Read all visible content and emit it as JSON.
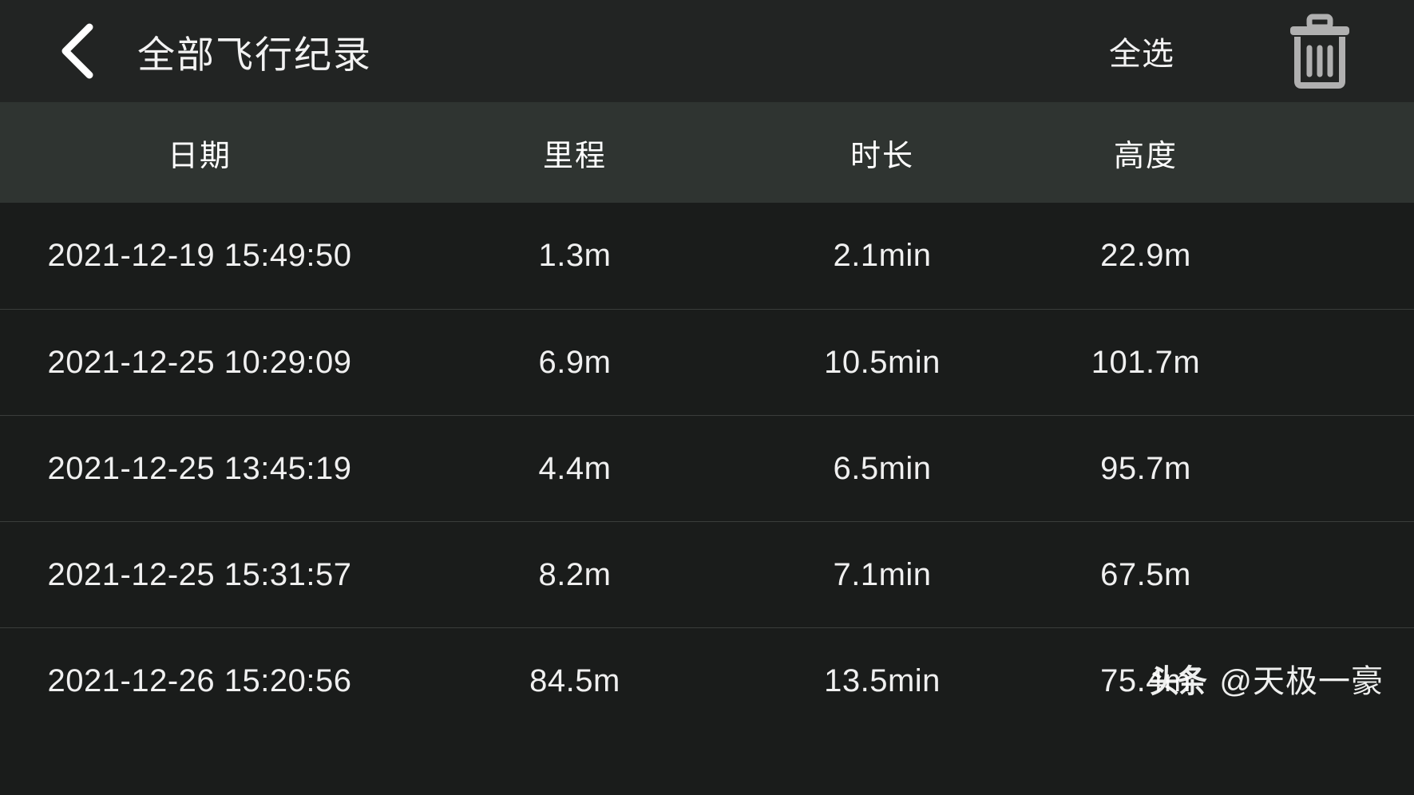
{
  "navbar": {
    "back_icon": "chevron-left-icon",
    "title": "全部飞行纪录",
    "select_all_label": "全选",
    "delete_icon": "trash-icon"
  },
  "table": {
    "columns": [
      {
        "key": "date",
        "label": "日期"
      },
      {
        "key": "distance",
        "label": "里程"
      },
      {
        "key": "duration",
        "label": "时长"
      },
      {
        "key": "altitude",
        "label": "高度"
      }
    ],
    "rows": [
      {
        "date": "2021-12-19 15:49:50",
        "distance": "1.3m",
        "duration": "2.1min",
        "altitude": "22.9m"
      },
      {
        "date": "2021-12-25 10:29:09",
        "distance": "6.9m",
        "duration": "10.5min",
        "altitude": "101.7m"
      },
      {
        "date": "2021-12-25 13:45:19",
        "distance": "4.4m",
        "duration": "6.5min",
        "altitude": "95.7m"
      },
      {
        "date": "2021-12-25 15:31:57",
        "distance": "8.2m",
        "duration": "7.1min",
        "altitude": "67.5m"
      },
      {
        "date": "2021-12-26 15:20:56",
        "distance": "84.5m",
        "duration": "13.5min",
        "altitude": "75.4m"
      }
    ]
  },
  "watermark": {
    "logo_text": "头条",
    "username": "@天极一豪"
  },
  "colors": {
    "page_background": "#1a1c1b",
    "navbar_background": "#222423",
    "header_row_background": "#2f3431",
    "row_divider": "#3a3d3b",
    "primary_text": "#f2f2f2",
    "icon_grey": "#b3b3b3"
  }
}
